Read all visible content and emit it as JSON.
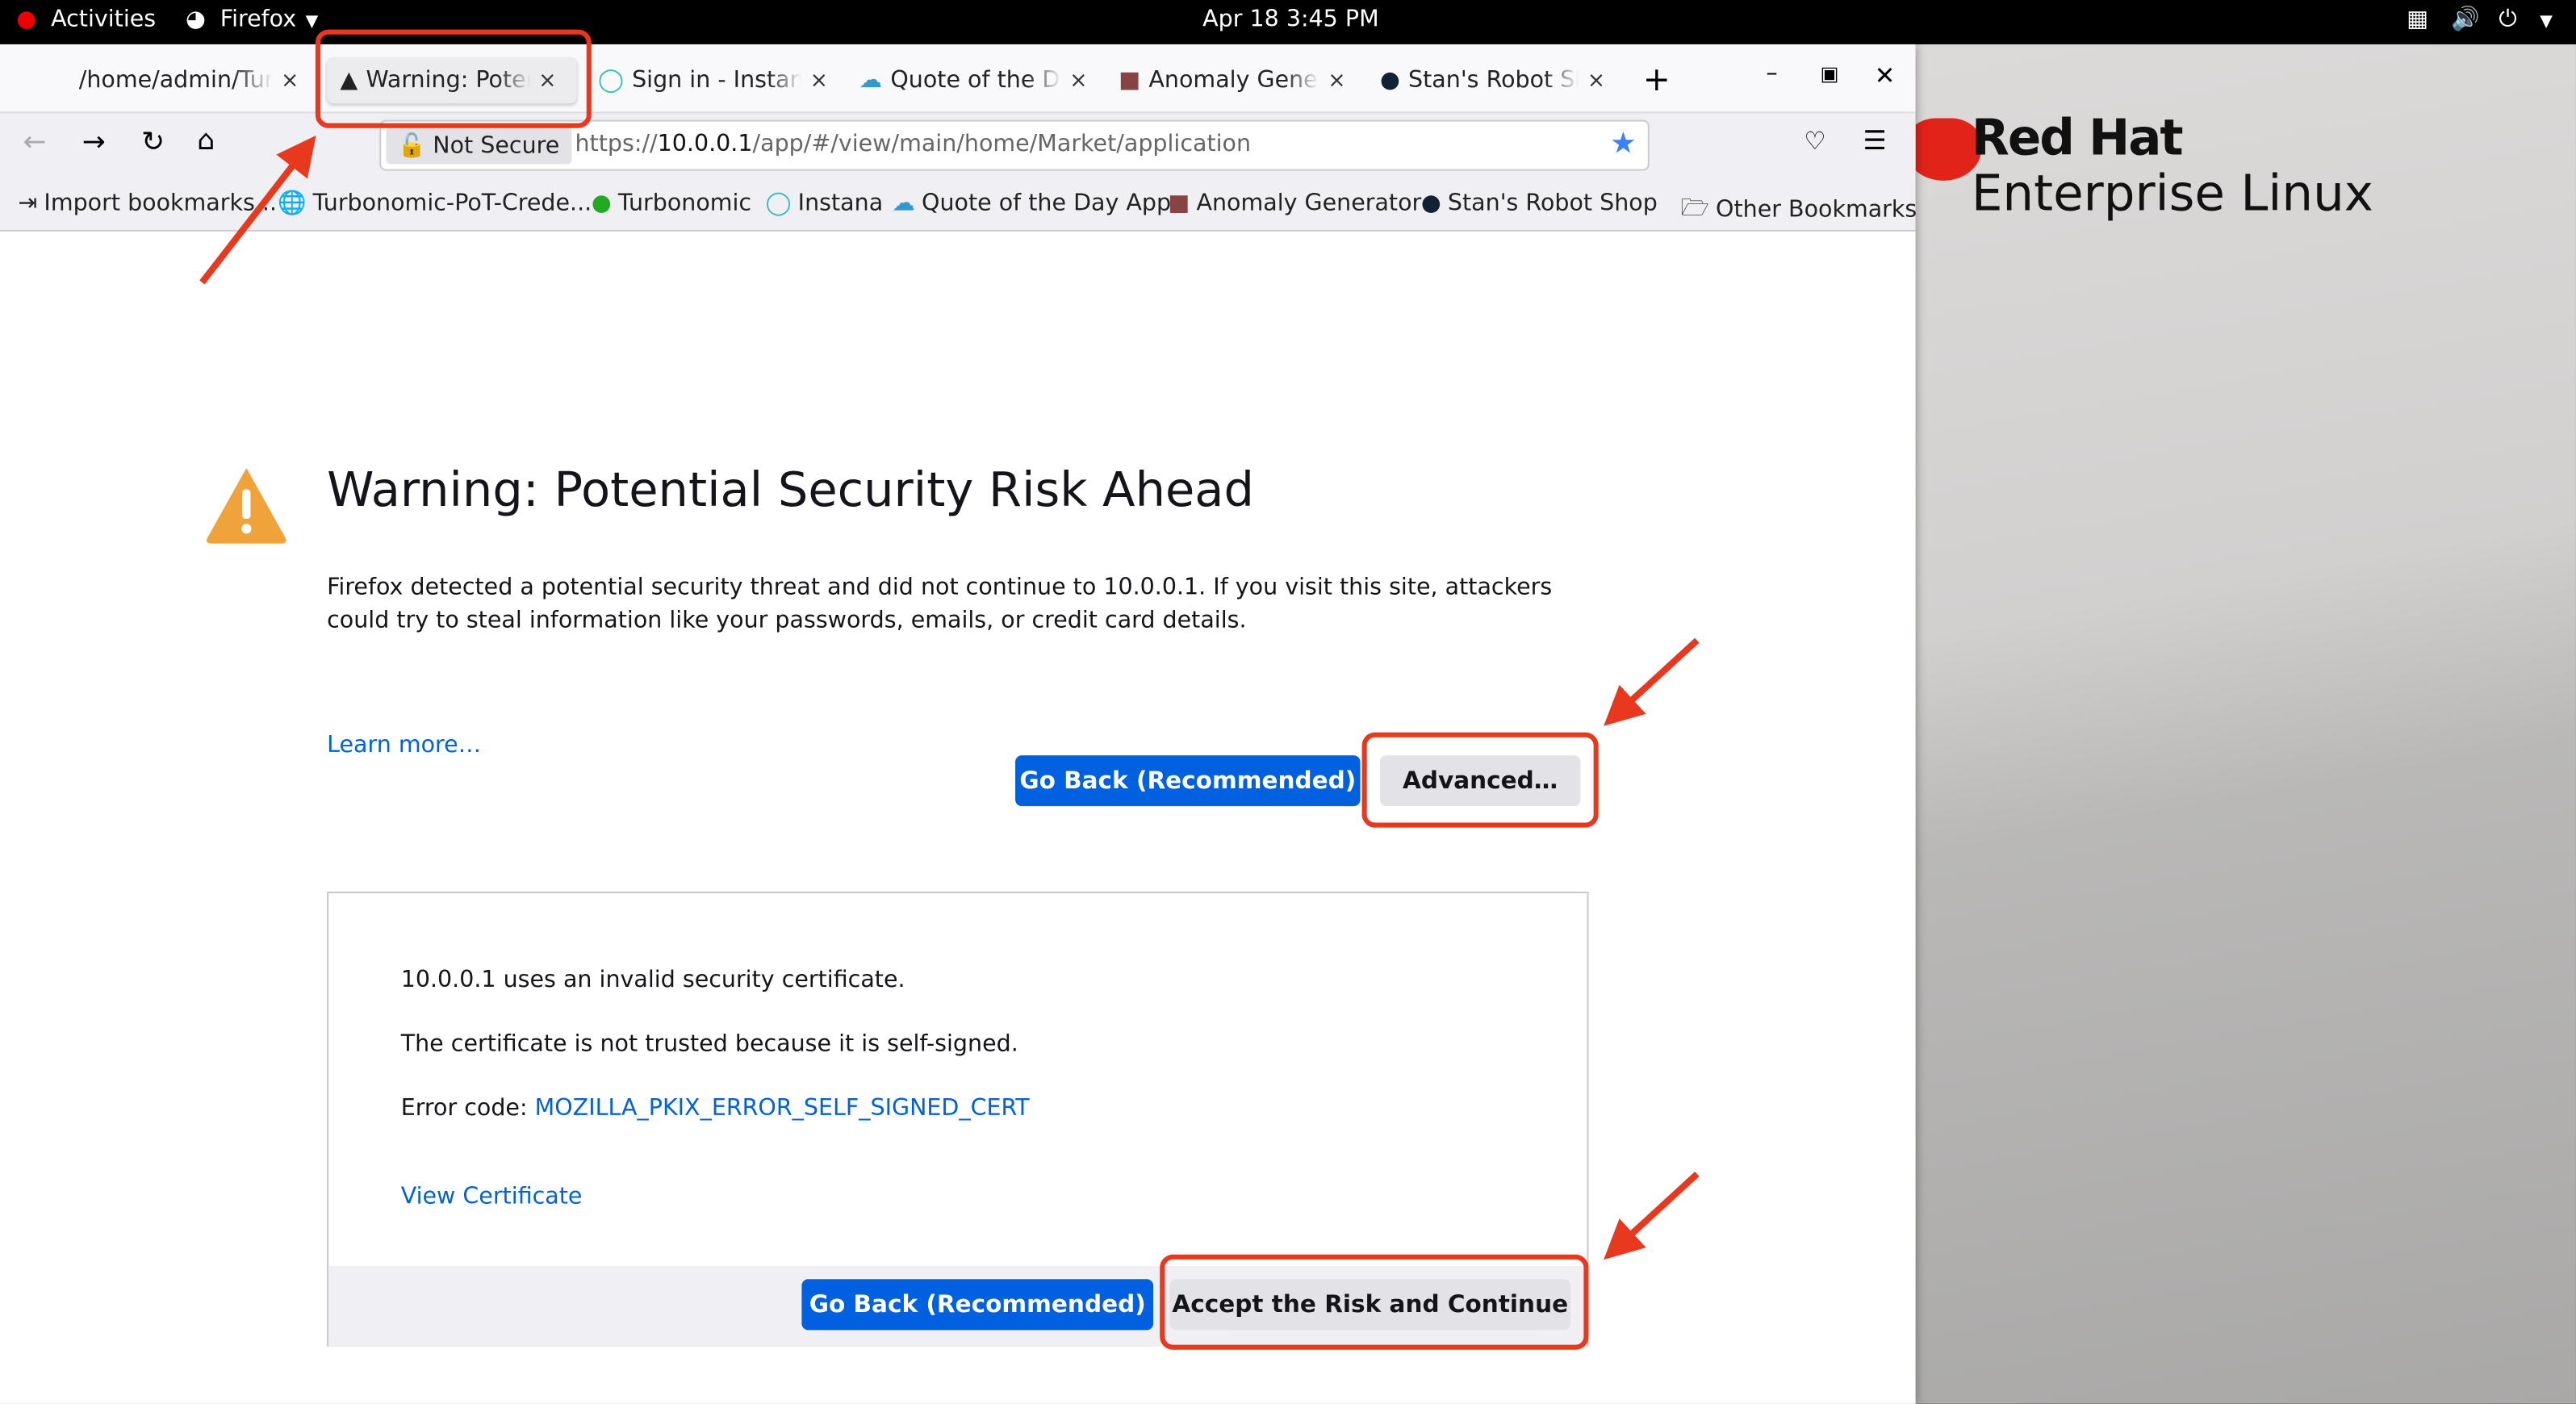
{
  "topbar": {
    "activities": "Activities",
    "app": "Firefox",
    "datetime": "Apr 18  3:45 PM"
  },
  "tabs": [
    {
      "label": "/home/admin/Turbo",
      "close": "×"
    },
    {
      "label": "Warning: Potent",
      "close": "×",
      "active": true
    },
    {
      "label": "Sign in - Instana",
      "close": "×"
    },
    {
      "label": "Quote of the Da",
      "close": "×"
    },
    {
      "label": "Anomaly Genera",
      "close": "×"
    },
    {
      "label": "Stan's Robot Sh",
      "close": "×"
    }
  ],
  "new_tab": "+",
  "navbar": {
    "not_secure": "Not Secure",
    "url_prefix": "https://",
    "url_host": "10.0.0.1",
    "url_path": "/app/#/view/main/home/Market/application"
  },
  "bookmarks": [
    "Import bookmarks...",
    "Turbonomic-PoT-Crede...",
    "Turbonomic",
    "Instana",
    "Quote of the Day App",
    "Anomaly Generator",
    "Stan's Robot Shop"
  ],
  "other_bookmarks": "Other Bookmarks",
  "page": {
    "title": "Warning: Potential Security Risk Ahead",
    "description": "Firefox detected a potential security threat and did not continue to 10.0.0.1. If you visit this site, attackers could try to steal information like your passwords, emails, or credit card details.",
    "learn_more": "Learn more…",
    "go_back": "Go Back (Recommended)",
    "advanced": "Advanced…",
    "advanced_panel": {
      "line1": "10.0.0.1 uses an invalid security certificate.",
      "line2": "The certificate is not trusted because it is self-signed.",
      "error_label": "Error code: ",
      "error_code": "MOZILLA_PKIX_ERROR_SELF_SIGNED_CERT",
      "view_certificate": "View Certificate",
      "go_back": "Go Back (Recommended)",
      "accept": "Accept the Risk and Continue"
    }
  },
  "desktop": {
    "brand_line1": "Red Hat",
    "brand_line2": "Enterprise Linux"
  },
  "colors": {
    "accent": "#0061e0",
    "warning": "#f0a33a",
    "annotation": "#e8391f"
  }
}
